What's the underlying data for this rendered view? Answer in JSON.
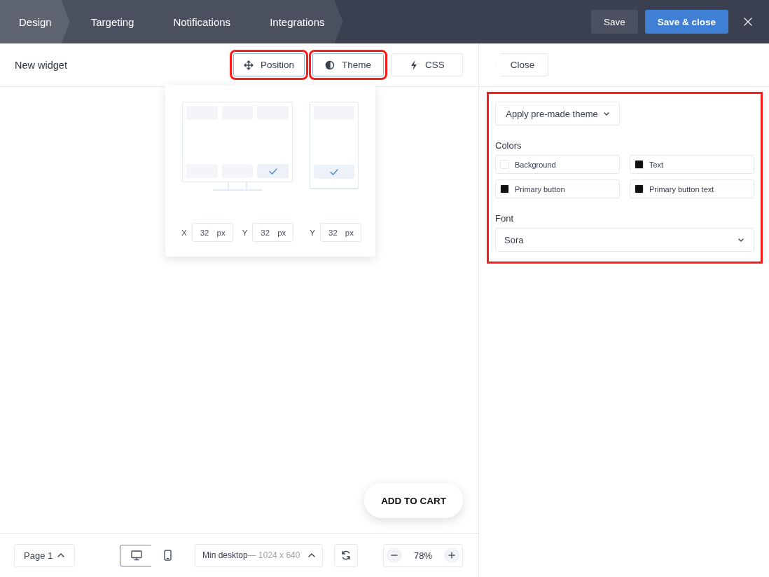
{
  "tabs": [
    {
      "label": "Design",
      "selected": true
    },
    {
      "label": "Targeting",
      "selected": false
    },
    {
      "label": "Notifications",
      "selected": false
    },
    {
      "label": "Integrations",
      "selected": false
    }
  ],
  "header_actions": {
    "save": "Save",
    "save_close": "Save & close"
  },
  "editor": {
    "title": "New widget",
    "toolbar": [
      {
        "kind": "move",
        "label": "Position",
        "highlighted": true
      },
      {
        "kind": "contrast",
        "label": "Theme",
        "highlighted": true
      },
      {
        "kind": "bolt",
        "label": "CSS",
        "highlighted": false
      }
    ],
    "position_popover": {
      "desktop_slots": [
        {
          "selected": false
        },
        {
          "selected": false
        },
        {
          "selected": false
        },
        {
          "selected": false
        },
        {
          "selected": false
        },
        {
          "selected": true
        }
      ],
      "mobile_slots": [
        {
          "selected": false
        },
        {
          "selected": true
        }
      ],
      "fields": [
        {
          "label": "X",
          "value": "32",
          "unit": "px"
        },
        {
          "label": "Y",
          "value": "32",
          "unit": "px"
        },
        {
          "label": "Y",
          "value": "32",
          "unit": "px"
        }
      ]
    },
    "preview_button": "ADD TO CART",
    "bottom_bar": {
      "page": "Page 1",
      "devices": [
        {
          "kind": "desktop",
          "selected": true
        },
        {
          "kind": "mobile",
          "selected": false
        }
      ],
      "size": {
        "name": "Min desktop",
        "dimensions": "— 1024 x 640"
      },
      "zoom": "78%"
    }
  },
  "theme_panel": {
    "close": "Close",
    "highlighted": true,
    "premade": "Apply pre-made theme",
    "colors_label": "Colors",
    "colors": [
      {
        "label": "Background",
        "color": "#ffffff"
      },
      {
        "label": "Text",
        "color": "#111111"
      },
      {
        "label": "Primary button",
        "color": "#111111"
      },
      {
        "label": "Primary button text",
        "color": "#111111"
      }
    ],
    "font_label": "Font",
    "font": "Sora"
  }
}
